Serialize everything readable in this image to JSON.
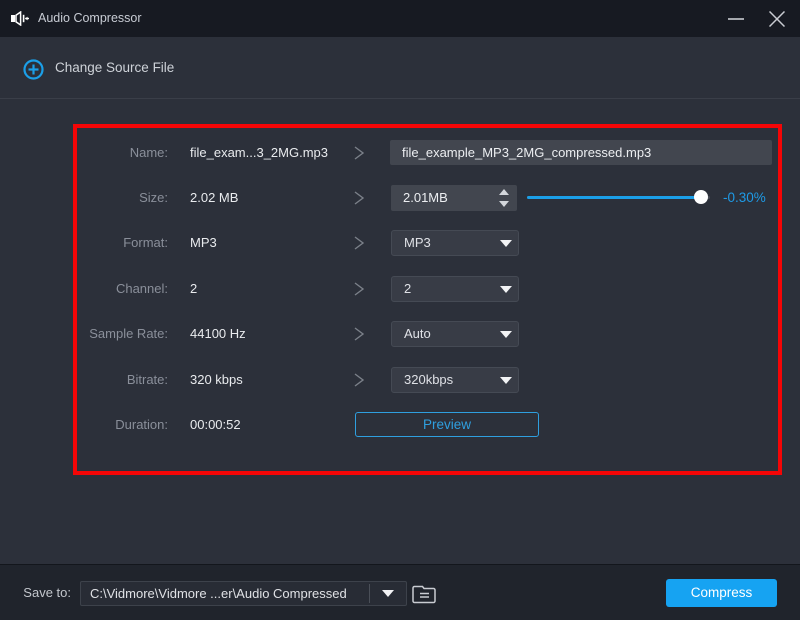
{
  "window": {
    "title": "Audio Compressor"
  },
  "toolbar": {
    "change_source_label": "Change Source File"
  },
  "form": {
    "rows": [
      {
        "label": "Name:",
        "value": "file_exam...3_2MG.mp3"
      },
      {
        "label": "Size:",
        "value": "2.02 MB"
      },
      {
        "label": "Format:",
        "value": "MP3"
      },
      {
        "label": "Channel:",
        "value": "2"
      },
      {
        "label": "Sample Rate:",
        "value": "44100 Hz"
      },
      {
        "label": "Bitrate:",
        "value": "320 kbps"
      },
      {
        "label": "Duration:",
        "value": "00:00:52"
      }
    ],
    "name_input": "file_example_MP3_2MG_compressed.mp3",
    "size_input": "2.01MB",
    "size_change": "-0.30%",
    "format_select": "MP3",
    "channel_select": "2",
    "sample_rate_select": "Auto",
    "bitrate_select": "320kbps",
    "preview_button": "Preview"
  },
  "footer": {
    "save_to_label": "Save to:",
    "save_path": "C:\\Vidmore\\Vidmore ...er\\Audio Compressed",
    "compress_button": "Compress"
  },
  "colors": {
    "accent_blue": "#1b9fe8",
    "compress_blue": "#16a3f2",
    "annotation_red": "#f50506",
    "background": "#2c303a",
    "titlebar": "#171a22",
    "bottombar": "#20242c"
  }
}
